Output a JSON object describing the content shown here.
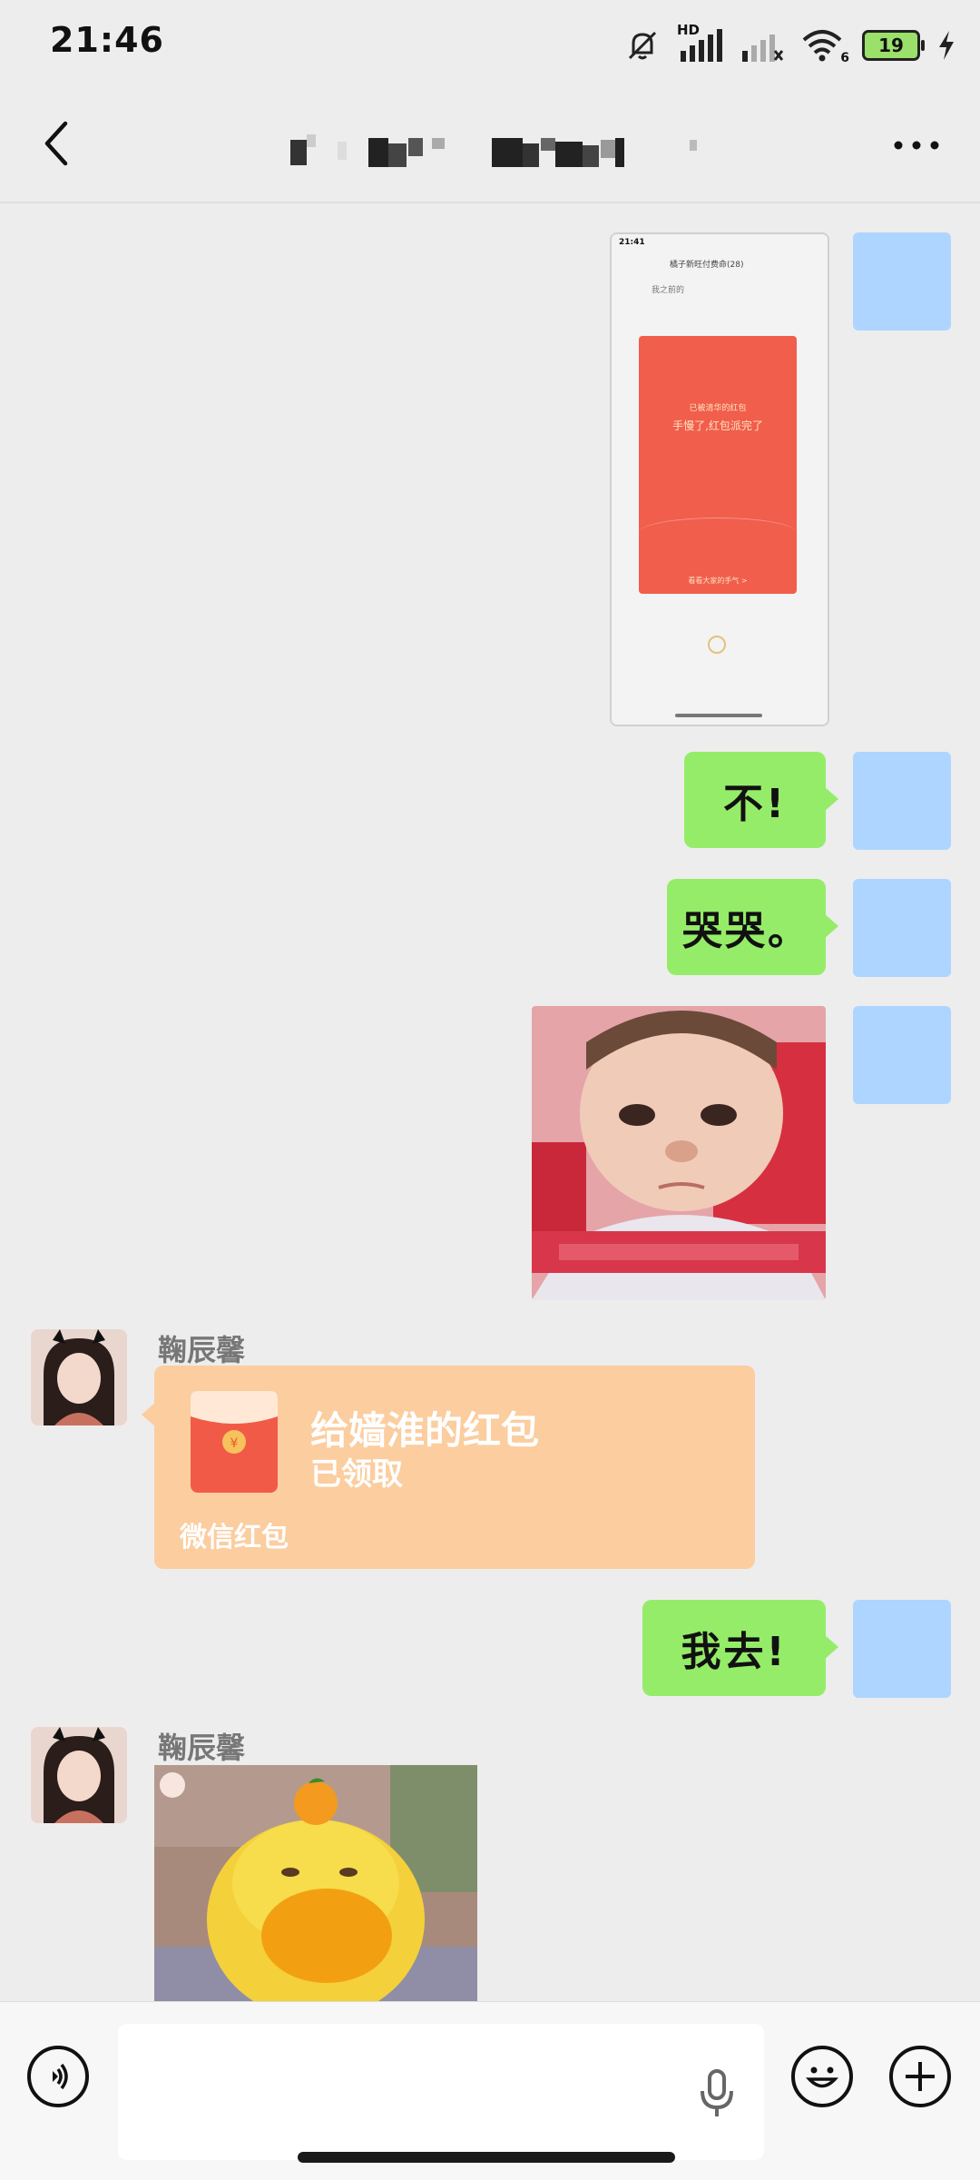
{
  "status_bar": {
    "time": "21:46",
    "network_label": "HD",
    "wifi_label": "6",
    "battery_level": "19",
    "icons": [
      "mute-bell-icon",
      "signal-hd-icon",
      "signal-weak-icon",
      "wifi-icon",
      "battery-icon",
      "charging-icon"
    ]
  },
  "nav": {
    "back_icon": "chevron-left-icon",
    "more_icon": "more-dots-icon"
  },
  "messages": [
    {
      "from": "me",
      "type": "image",
      "content": "screenshot-red-packet"
    },
    {
      "from": "me",
      "type": "text",
      "text": "不!"
    },
    {
      "from": "me",
      "type": "text",
      "text": "哭哭。"
    },
    {
      "from": "me",
      "type": "image",
      "content": "baby-sticker"
    },
    {
      "from": "other",
      "sender": "鞠辰馨",
      "type": "red_packet",
      "title": "给嫱淮的红包",
      "status": "已领取",
      "footer": "微信红包"
    },
    {
      "from": "me",
      "type": "text",
      "text": "我去!"
    },
    {
      "from": "other",
      "sender": "鞠辰馨",
      "type": "image",
      "content": "duck-sticker"
    }
  ],
  "screenshot_msg": {
    "mini_time": "21:41",
    "mini_title": "橘子新旺付费命(28)",
    "mini_chat_line": "我之前的",
    "mini_packet_from": "已被清华的红包",
    "mini_packet_text": "手慢了,红包派完了",
    "mini_packet_link": "看看大家的手气 >"
  },
  "input_bar": {
    "voice_icon": "voice-toggle-icon",
    "mic_icon": "microphone-icon",
    "emoji_icon": "emoji-icon",
    "plus_icon": "plus-icon"
  },
  "colors": {
    "background": "#EDEDED",
    "my_bubble": "#95EC69",
    "self_avatar": "#ADD5FF",
    "red_packet": "#FBCD9F"
  }
}
